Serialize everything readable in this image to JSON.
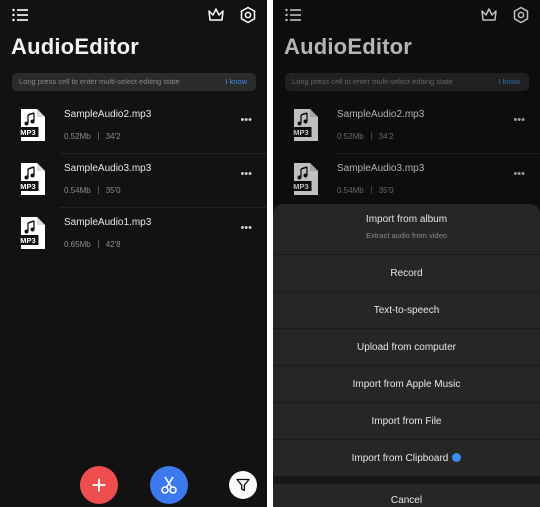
{
  "app": {
    "title": "AudioEditor",
    "hint": "Long press cell to enter multi-select editing state",
    "hint_action": "I know"
  },
  "icons": {
    "menu": "menu-list-icon",
    "vip": "crown-icon",
    "settings": "gear-icon",
    "file": "mp3-file-icon",
    "more": "more-dots-icon",
    "add": "plus-icon",
    "cut": "scissors-icon",
    "filter": "funnel-icon"
  },
  "files": [
    {
      "name": "SampleAudio2.mp3",
      "size": "0.52Mb",
      "duration": "34'2",
      "badge": "MP3"
    },
    {
      "name": "SampleAudio3.mp3",
      "size": "0.54Mb",
      "duration": "35'0",
      "badge": "MP3"
    },
    {
      "name": "SampleAudio1.mp3",
      "size": "0.65Mb",
      "duration": "42'8",
      "badge": "MP3"
    }
  ],
  "more_label": "•••",
  "fab": {
    "add": "+"
  },
  "sheet": {
    "album_title": "Import from album",
    "album_sub": "Extract audio from video",
    "items": [
      "Record",
      "Text-to-speech",
      "Upload from computer",
      "Import from Apple Music",
      "Import from File",
      "Import from Clipboard"
    ],
    "cancel": "Cancel"
  },
  "colors": {
    "background": "#121212",
    "accent_blue": "#3c78ee",
    "accent_red": "#ef4e4e",
    "link_blue": "#3d8ef0"
  }
}
